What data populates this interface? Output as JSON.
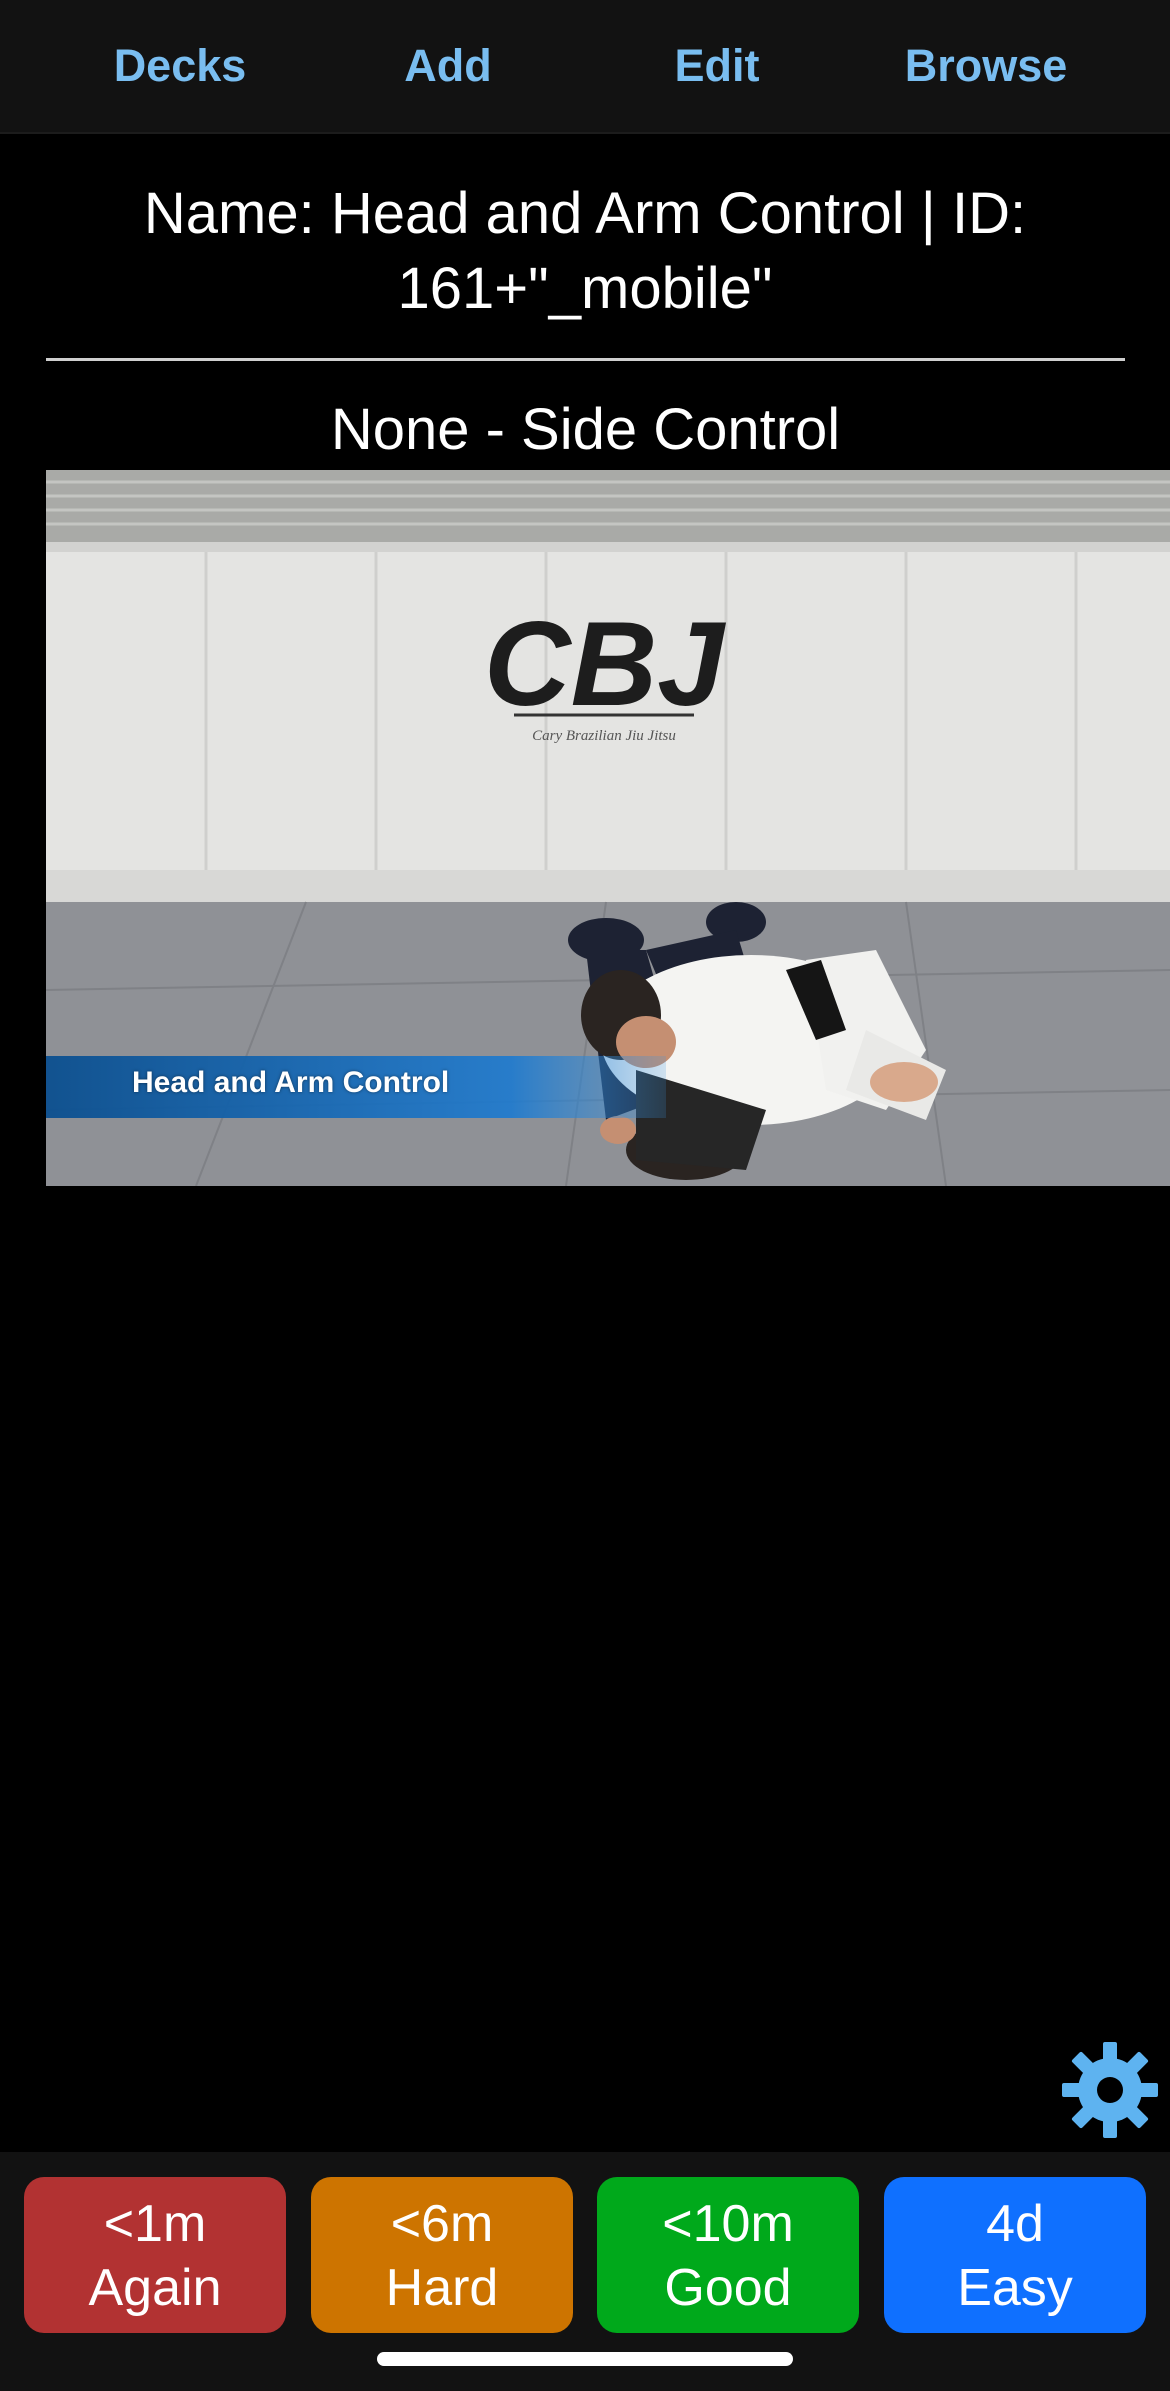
{
  "nav": {
    "decks": "Decks",
    "add": "Add",
    "edit": "Edit",
    "browse": "Browse"
  },
  "card": {
    "title": "Name: Head and Arm Control | ID: 161+\"_mobile\"",
    "subtitle": "None - Side Control",
    "video": {
      "wall_logo": "CBJ",
      "wall_logo_sub": "Cary Brazilian Jiu Jitsu",
      "caption": "Head and Arm Control"
    }
  },
  "answers": [
    {
      "interval": "<1m",
      "label": "Again",
      "color": "#b23232"
    },
    {
      "interval": "<6m",
      "label": "Hard",
      "color": "#cd7400"
    },
    {
      "interval": "<10m",
      "label": "Good",
      "color": "#00a91b"
    },
    {
      "interval": "4d",
      "label": "Easy",
      "color": "#0f70ff"
    }
  ],
  "icons": {
    "settings": "gear-icon"
  },
  "colors": {
    "nav_text": "#79bdf0",
    "background": "#000000",
    "bar_background": "#121212",
    "gear": "#5eb3f0"
  }
}
